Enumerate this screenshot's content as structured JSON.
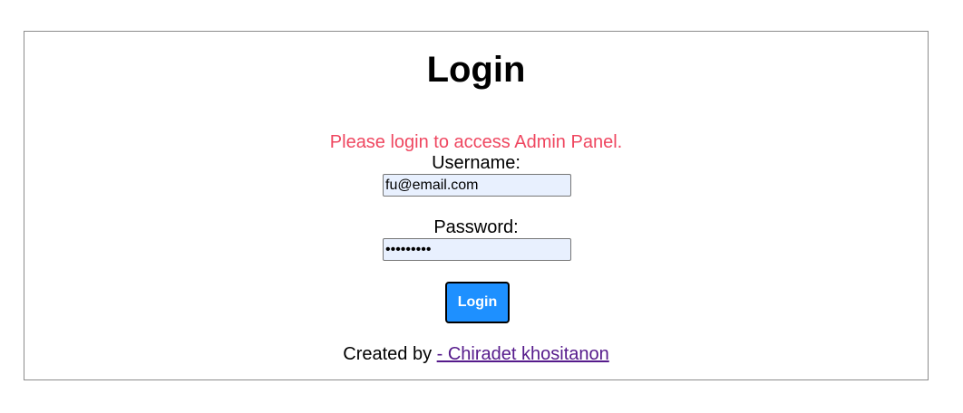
{
  "login_panel": {
    "title": "Login",
    "notice": "Please login to access Admin Panel.",
    "username_label": "Username:",
    "username_value": "fu@email.com",
    "password_label": "Password:",
    "password_value": "•••••••••",
    "login_button_label": "Login",
    "footer_prefix": "Created by ",
    "footer_link_text": "- Chiradet khositanon"
  },
  "colors": {
    "notice": "#ef4760",
    "button_bg": "#1e90ff",
    "input_bg": "#e8f0fe",
    "link_visited": "#551a8b"
  }
}
